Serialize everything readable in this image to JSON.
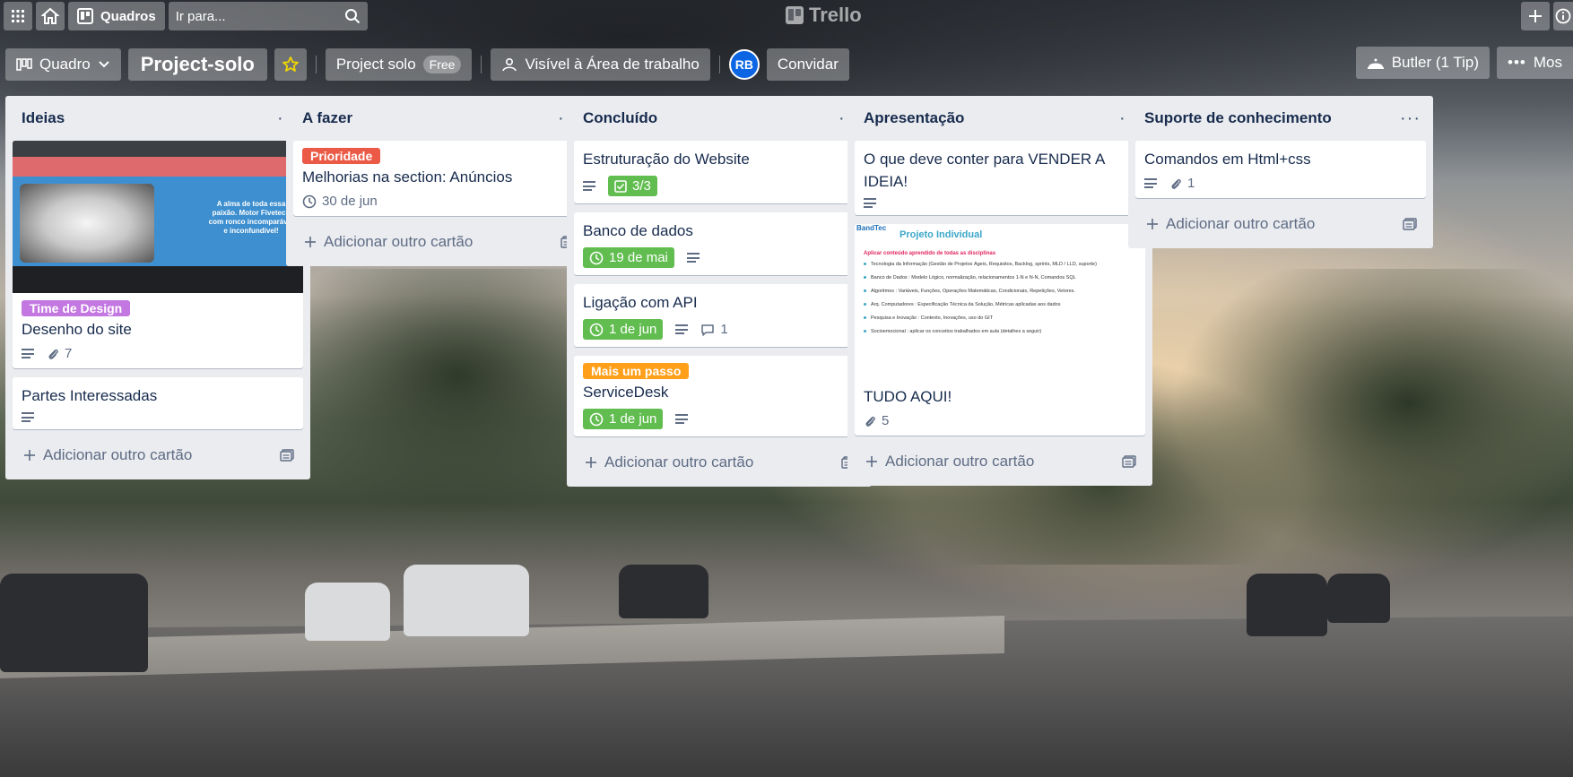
{
  "header": {
    "boards_label": "Quadros",
    "search_placeholder": "Ir para...",
    "logo_text": "Trello"
  },
  "board": {
    "view_label": "Quadro",
    "title": "Project-solo",
    "workspace_label": "Project solo",
    "plan_badge": "Free",
    "visibility_label": "Visível à Área de trabalho",
    "member_initials": "RB",
    "invite_label": "Convidar",
    "butler_label": "Butler (1 Tip)",
    "more_label": "Mos"
  },
  "lists": [
    {
      "title": "Ideias",
      "cards": [
        {
          "label": "Time de Design",
          "label_color": "#c377e0",
          "title": "Desenho do site",
          "attachments": "7"
        },
        {
          "title": "Partes Interessadas"
        }
      ],
      "add_card": "Adicionar outro cartão"
    },
    {
      "title": "A fazer",
      "cards": [
        {
          "label": "Prioridade",
          "label_color": "#eb5a46",
          "title": "Melhorias na section: Anúncios",
          "due": "30 de jun"
        }
      ],
      "add_card": "Adicionar outro cartão"
    },
    {
      "title": "Concluído",
      "cards": [
        {
          "title": "Estruturação do Website",
          "checklist": "3/3"
        },
        {
          "title": "Banco de dados",
          "due": "19 de mai"
        },
        {
          "title": "Ligação com API",
          "due": "1 de jun",
          "comments": "1"
        },
        {
          "label": "Mais um passo",
          "label_color": "#ff9f1a",
          "title": "ServiceDesk",
          "due": "1 de jun"
        }
      ],
      "add_card": "Adicionar outro cartão"
    },
    {
      "title": "Apresentação",
      "cards": [
        {
          "title": "O que deve conter para VENDER A IDEIA!"
        },
        {
          "title": "TUDO AQUI!",
          "attachments": "5"
        }
      ],
      "add_card": "Adicionar outro cartão"
    },
    {
      "title": "Suporte de conhecimento",
      "cards": [
        {
          "title": "Comandos em Html+css",
          "attachments": "1"
        }
      ],
      "add_card": "Adicionar outro cartão"
    }
  ],
  "cover_site": {
    "hero_text": "A alma de toda essa paixão. Motor Fivetech com ronco incomparável e inconfundível!"
  },
  "cover_doc": {
    "brand": "BandTec",
    "heading": "Projeto Individual",
    "subheading": "Aplicar conteúdo aprendido de todas as disciplinas",
    "items": [
      "Tecnologia da Informação (Gestão de Projetos Ágeis, Requisitos, Backlog, sprints, MLD / LLD, suporte)",
      "Banco de Dados : Modelo Lógico, normalização, relacionamentos 1-N e N-N, Comandos SQL",
      "Algoritmos : Variáveis, Funções, Operações Matemáticas, Condicionais, Repetições, Vetores.",
      "Arq. Computadores : Especificação Técnica da Solução, Métricas aplicadas aos dados",
      "Pesquisa e Inovação : Contexto, Inovações, uso do GIT",
      "Socioemocional : aplicar os conceitos trabalhados em aula (detalhes a seguir)"
    ]
  },
  "colors": {
    "accent_green": "#61bd4f",
    "list_bg": "#ebecf0",
    "avatar_blue": "#0c66e4"
  }
}
